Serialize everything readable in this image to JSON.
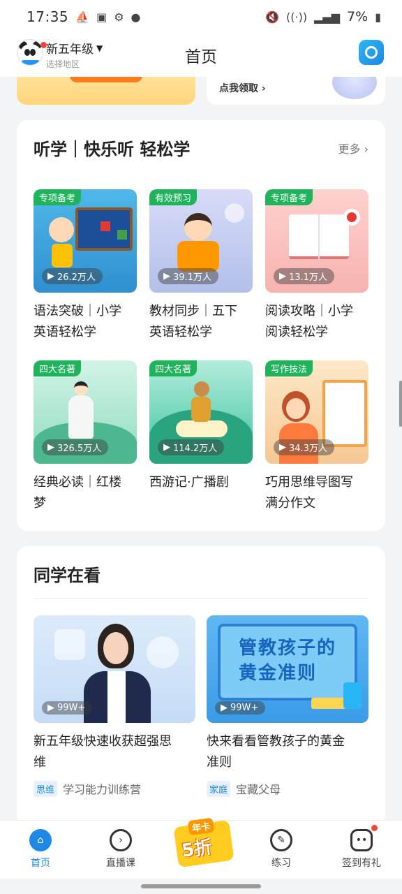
{
  "status_bar": {
    "time": "17:35",
    "battery": "7%"
  },
  "header": {
    "grade": "新五年级",
    "region": "选择地区",
    "title": "首页"
  },
  "banner": {
    "right_link": "点我领取"
  },
  "section1": {
    "title": "听学｜快乐听 轻松学",
    "more": "更多",
    "tiles": [
      {
        "tag": "专项备考",
        "plays": "26.2万人",
        "title_line1": "语法突破｜小学",
        "title_line2": "英语轻松学"
      },
      {
        "tag": "有效预习",
        "plays": "39.1万人",
        "title_line1": "教材同步｜五下",
        "title_line2": "英语轻松学"
      },
      {
        "tag": "专项备考",
        "plays": "13.1万人",
        "title_line1": "阅读攻略｜小学",
        "title_line2": "阅读轻松学"
      },
      {
        "tag": "四大名著",
        "plays": "326.5万人",
        "title_line1": "经典必读｜红楼",
        "title_line2": "梦"
      },
      {
        "tag": "四大名著",
        "plays": "114.2万人",
        "title_line1": "西游记·广播剧",
        "title_line2": ""
      },
      {
        "tag": "写作技法",
        "plays": "34.3万人",
        "title_line1": "巧用思维导图写",
        "title_line2": "满分作文"
      }
    ]
  },
  "section2": {
    "title": "同学在看",
    "videos": [
      {
        "plays": "99W+",
        "title_line1": "新五年级快速收获超强思",
        "title_line2": "维",
        "category": "思维",
        "series": "学习能力训练营"
      },
      {
        "plays": "99W+",
        "title_line1": "快来看看管教孩子的黄金",
        "title_line2": "准则",
        "category": "家庭",
        "series": "宝藏父母",
        "poster_line1": "管教孩子的",
        "poster_line2": "黄金准则"
      }
    ]
  },
  "tabbar": {
    "tabs": [
      {
        "label": "首页"
      },
      {
        "label": "直播课"
      },
      {
        "label": "练习"
      },
      {
        "label": "签到有礼"
      }
    ],
    "promo_line1": "年卡",
    "promo_line2": "5折"
  },
  "colors": {
    "accent": "#1e88e5",
    "tag_green": "#1fb45b",
    "badge_red": "#f44336"
  }
}
